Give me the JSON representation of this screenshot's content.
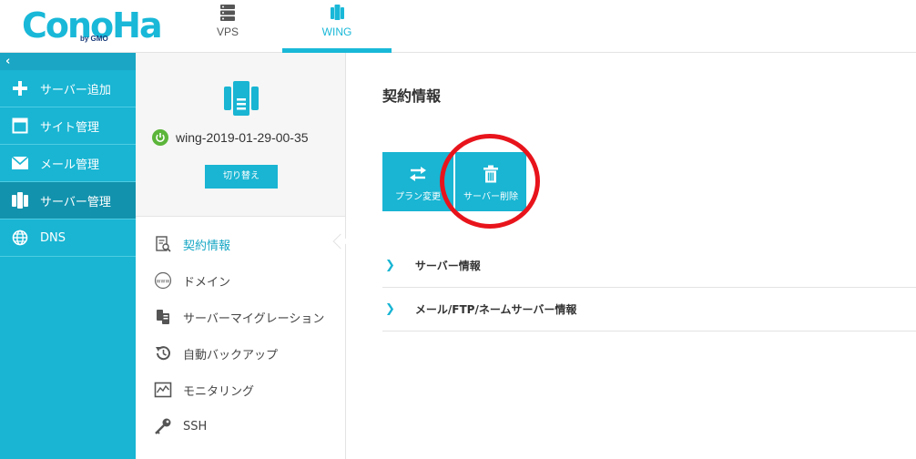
{
  "header": {
    "logo": "ConoHa",
    "logo_by": "by GMO",
    "tabs": [
      {
        "label": "VPS",
        "icon": "server-stack-icon"
      },
      {
        "label": "WING",
        "icon": "wing-server-icon",
        "active": true
      }
    ]
  },
  "sidebar": {
    "collapse": "‹",
    "items": [
      {
        "label": "サーバー追加",
        "icon": "plus-icon"
      },
      {
        "label": "サイト管理",
        "icon": "window-icon"
      },
      {
        "label": "メール管理",
        "icon": "mail-icon"
      },
      {
        "label": "サーバー管理",
        "icon": "server-icon",
        "active": true
      },
      {
        "label": "DNS",
        "icon": "globe-icon"
      }
    ]
  },
  "server_panel": {
    "name": "wing-2019-01-29-00-35",
    "switch_label": "切り替え"
  },
  "sub_menu": [
    {
      "label": "契約情報",
      "icon": "contract-icon",
      "active": true
    },
    {
      "label": "ドメイン",
      "icon": "www-icon"
    },
    {
      "label": "サーバーマイグレーション",
      "icon": "migration-icon"
    },
    {
      "label": "自動バックアップ",
      "icon": "backup-icon"
    },
    {
      "label": "モニタリング",
      "icon": "monitoring-icon"
    },
    {
      "label": "SSH",
      "icon": "key-icon"
    }
  ],
  "main": {
    "title": "契約情報",
    "actions": [
      {
        "label": "プラン変更",
        "icon": "swap-icon"
      },
      {
        "label": "サーバー削除",
        "icon": "trash-icon"
      }
    ],
    "sections": [
      {
        "label": "サーバー情報"
      },
      {
        "label": "メール/FTP/ネームサーバー情報"
      }
    ]
  },
  "colors": {
    "accent": "#19b5d3",
    "sidebar_active": "#1292ad",
    "highlight_circle": "#e8141c",
    "power_on": "#5bb53a"
  }
}
